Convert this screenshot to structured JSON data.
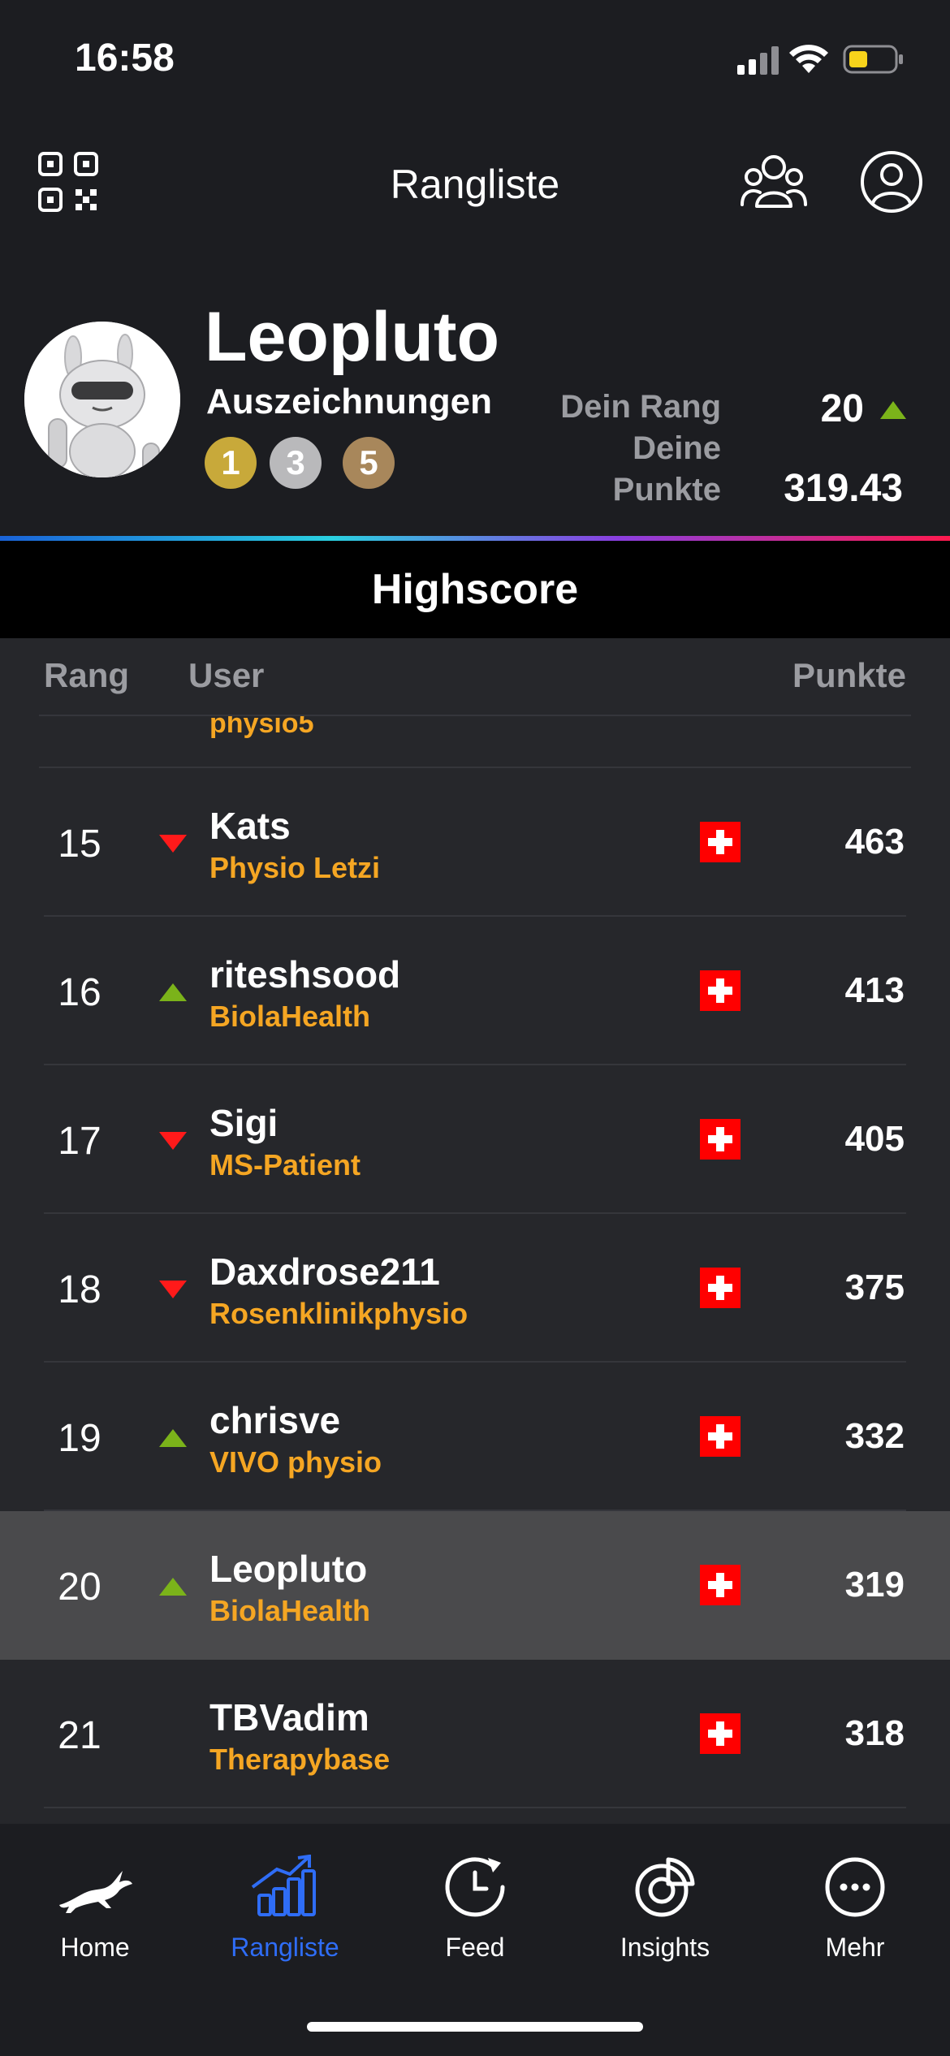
{
  "status_bar": {
    "time": "16:58"
  },
  "header": {
    "title": "Rangliste"
  },
  "profile": {
    "name": "Leopluto",
    "awards_label": "Auszeichnungen",
    "medals": {
      "gold": "1",
      "silver": "3",
      "bronze": "5"
    },
    "rank_label": "Dein Rang",
    "rank_value": "20",
    "points_label": "Deine Punkte",
    "points_value": "319.43"
  },
  "highscore": {
    "title": "Highscore",
    "columns": {
      "rank": "Rang",
      "user": "User",
      "points": "Punkte"
    },
    "partial_row_team": "physio5",
    "rows": [
      {
        "rank": "15",
        "trend": "down",
        "user": "Kats",
        "team": "Physio Letzi",
        "points": "463",
        "highlight": false
      },
      {
        "rank": "16",
        "trend": "up",
        "user": "riteshsood",
        "team": "BiolaHealth",
        "points": "413",
        "highlight": false
      },
      {
        "rank": "17",
        "trend": "down",
        "user": "Sigi",
        "team": "MS-Patient",
        "points": "405",
        "highlight": false
      },
      {
        "rank": "18",
        "trend": "down",
        "user": "Daxdrose211",
        "team": "Rosenklinikphysio",
        "points": "375",
        "highlight": false
      },
      {
        "rank": "19",
        "trend": "up",
        "user": "chrisve",
        "team": "VIVO physio",
        "points": "332",
        "highlight": false
      },
      {
        "rank": "20",
        "trend": "up",
        "user": "Leopluto",
        "team": "BiolaHealth",
        "points": "319",
        "highlight": true
      },
      {
        "rank": "21",
        "trend": "none",
        "user": "TBVadim",
        "team": "Therapybase",
        "points": "318",
        "highlight": false
      }
    ]
  },
  "tabs": [
    {
      "label": "Home",
      "icon": "hare-icon",
      "active": false
    },
    {
      "label": "Rangliste",
      "icon": "ranking-chart-icon",
      "active": true
    },
    {
      "label": "Feed",
      "icon": "clock-refresh-icon",
      "active": false
    },
    {
      "label": "Insights",
      "icon": "pie-chart-icon",
      "active": false
    },
    {
      "label": "Mehr",
      "icon": "more-dots-icon",
      "active": false
    }
  ],
  "colors": {
    "background": "#1c1d21",
    "table_bg": "#26272b",
    "highlight_row": "#4a4a4c",
    "team_text": "#f5a623",
    "trend_up": "#7bb31a",
    "trend_down": "#ff1a1a",
    "active_tab": "#2f6df6"
  }
}
